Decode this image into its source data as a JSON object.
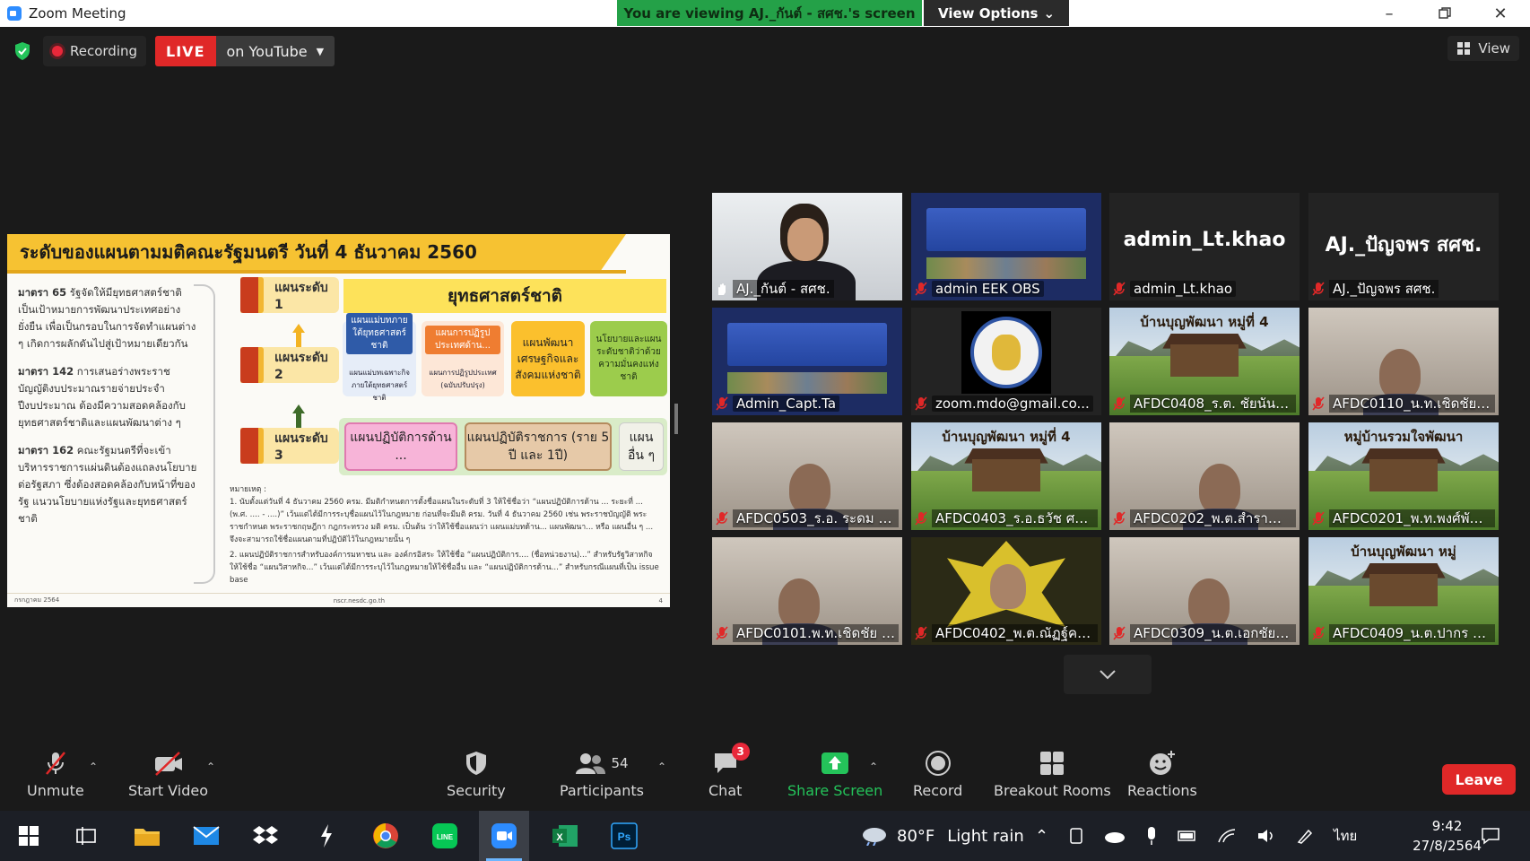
{
  "window": {
    "title": "Zoom Meeting",
    "viewing_banner": "You are viewing AJ._กันต์ - สศช.'s screen",
    "view_options": "View Options"
  },
  "topbar": {
    "recording_label": "Recording",
    "live_label": "LIVE",
    "stream_label": "on YouTube",
    "view_label": "View"
  },
  "slide": {
    "title": "ระดับของแผนตามมติคณะรัฐมนตรี วันที่ 4 ธันวาคม 2560",
    "left_paras": [
      {
        "bold": "มาตรา 65",
        "text": " รัฐจัดให้มียุทธศาสตร์ชาติเป็นเป้าหมายการพัฒนาประเทศอย่างยั่งยืน เพื่อเป็นกรอบในการจัดทำแผนต่าง ๆ เกิดการผลักดันไปสู่เป้าหมายเดียวกัน"
      },
      {
        "bold": "มาตรา 142",
        "text": " การเสนอร่างพระราชบัญญัติงบประมาณรายจ่ายประจำปีงบประมาณ ต้องมีความสอดคล้องกับยุทธศาสตร์ชาติและแผนพัฒนาต่าง ๆ"
      },
      {
        "bold": "มาตรา 162",
        "text": " คณะรัฐมนตรีที่จะเข้าบริหารราชการแผ่นดินต้องแถลงนโยบายต่อรัฐสภา ซึ่งต้องสอดคล้องกับหน้าที่ของรัฐ แนวนโยบายแห่งรัฐและยุทธศาสตร์ชาติ"
      }
    ],
    "level1": "แผนระดับ 1",
    "level2": "แผนระดับ 2",
    "level3": "แผนระดับ 3",
    "strategy": "ยุทธศาสตร์ชาติ",
    "lv2_boxes": [
      "แผนแม่บทภายใต้ยุทธศาสตร์ชาติ",
      "แผนการปฏิรูปประเทศด้าน...",
      "แผนพัฒนาเศรษฐกิจและสังคมแห่งชาติ",
      "นโยบายและแผนระดับชาติว่าด้วยความมั่นคงแห่งชาติ"
    ],
    "lv2_sub": [
      "แผนแม่บทเฉพาะกิจภายใต้ยุทธศาสตร์ชาติ",
      "แผนการปฏิรูปประเทศ (ฉบับปรับปรุง)"
    ],
    "lv3_boxes": [
      "แผนปฏิบัติการด้าน ...",
      "แผนปฏิบัติราชการ (ราย 5 ปี และ 1ปี)",
      "แผน อื่น ๆ"
    ],
    "notes_title": "หมายเหตุ :",
    "notes": [
      "1. นับตั้งแต่วันที่ 4 ธันวาคม 2560 ครม. มีมติกำหนดการตั้งชื่อแผนในระดับที่ 3 ให้ใช้ชื่อว่า “แผนปฏิบัติการด้าน ... ระยะที่ ... (พ.ศ. .... - ....)” เว้นแต่ได้มีการระบุชื่อแผนไว้ในกฎหมาย ก่อนที่จะมีมติ ครม. วันที่ 4 ธันวาคม 2560 เช่น พระราชบัญญัติ พระราชกำหนด พระราชกฤษฎีกา กฎกระทรวง มติ ครม. เป็นต้น ว่าให้ใช้ชื่อแผนว่า แผนแม่บทด้าน... แผนพัฒนา... หรือ แผนอื่น ๆ ... จึงจะสามารถใช้ชื่อแผนตามที่ปฏิบัติไว้ในกฎหมายนั้น ๆ",
      "2. แผนปฏิบัติราชการสำหรับองค์การมหาชน และ องค์กรอิสระ ให้ใช้ชื่อ “แผนปฏิบัติการ.... (ชื่อหน่วยงาน)...” สำหรับรัฐวิสาหกิจให้ใช้ชื่อ “แผนวิสาหกิจ...” เว้นแต่ได้มีการระบุไว้ในกฎหมายให้ใช้ชื่ออื่น และ “แผนปฏิบัติการด้าน...” สำหรับกรณีแผนที่เป็น issue base"
    ],
    "footer_left": "กรกฎาคม 2564",
    "footer_mid": "nscr.nesdc.go.th",
    "footer_right": "4"
  },
  "participants": [
    {
      "name": "AJ._กันต์ - สศช.",
      "kind": "camera",
      "active": true,
      "muted": false
    },
    {
      "name": "admin EEK OBS",
      "kind": "banner",
      "muted": true
    },
    {
      "name": "admin_Lt.khao",
      "kind": "text",
      "big": "admin_Lt.khao",
      "muted": true
    },
    {
      "name": "AJ._ปัญจพร สศช.",
      "kind": "text",
      "big": "AJ._ปัญจพร สศช.",
      "muted": true
    },
    {
      "name": "Admin_Capt.Ta",
      "kind": "banner",
      "muted": true
    },
    {
      "name": "zoom.mdo@gmail.co...",
      "kind": "logo",
      "muted": true
    },
    {
      "name": "AFDC0408_ร.ต. ชัยนันท์ ...",
      "kind": "scene",
      "scene_text": "บ้านบุญพัฒนา หมู่ที่ 4",
      "muted": true
    },
    {
      "name": "AFDC0110_น.ท.เชิดชัย ...",
      "kind": "room",
      "muted": true
    },
    {
      "name": "AFDC0503_ร.อ. ระดม ทอ...",
      "kind": "room",
      "muted": true
    },
    {
      "name": "AFDC0403_ร.อ.ธวัช ศรีจั...",
      "kind": "scene",
      "scene_text": "บ้านบุญพัฒนา หมู่ที่ 4",
      "muted": true
    },
    {
      "name": "AFDC0202_พ.ต.สำราญ ...",
      "kind": "room",
      "muted": true
    },
    {
      "name": "AFDC0201_พ.ท.พงศ์พัฒ...",
      "kind": "scene",
      "scene_text": "หมู่บ้านรวมใจพัฒนา",
      "muted": true
    },
    {
      "name": "AFDC0101.พ.ท.เชิดชัย ชู...",
      "kind": "room",
      "muted": true
    },
    {
      "name": "AFDC0402_พ.ต.ณัฏฐ์คเ...",
      "kind": "emblem",
      "muted": true
    },
    {
      "name": "AFDC0309_น.ต.เอกชัย ห้...",
      "kind": "room",
      "muted": true
    },
    {
      "name": "AFDC0409_น.ต.ปากร ศรี...",
      "kind": "scene",
      "scene_text": "บ้านบุญพัฒนา หมู่",
      "muted": true
    }
  ],
  "toolbar": {
    "unmute": "Unmute",
    "start_video": "Start Video",
    "security": "Security",
    "participants": "Participants",
    "participants_count": "54",
    "chat": "Chat",
    "chat_badge": "3",
    "share_screen": "Share Screen",
    "record": "Record",
    "breakout_rooms": "Breakout Rooms",
    "reactions": "Reactions",
    "leave": "Leave"
  },
  "taskbar": {
    "weather_temp": "80°F",
    "weather_text": "Light rain",
    "lang": "ไทย",
    "time": "9:42",
    "date": "27/8/2564"
  },
  "colors": {
    "banner_green": "#24a148",
    "live_red": "#e02828",
    "active_outline": "#c7e047",
    "slide_yellow": "#f6c232"
  }
}
